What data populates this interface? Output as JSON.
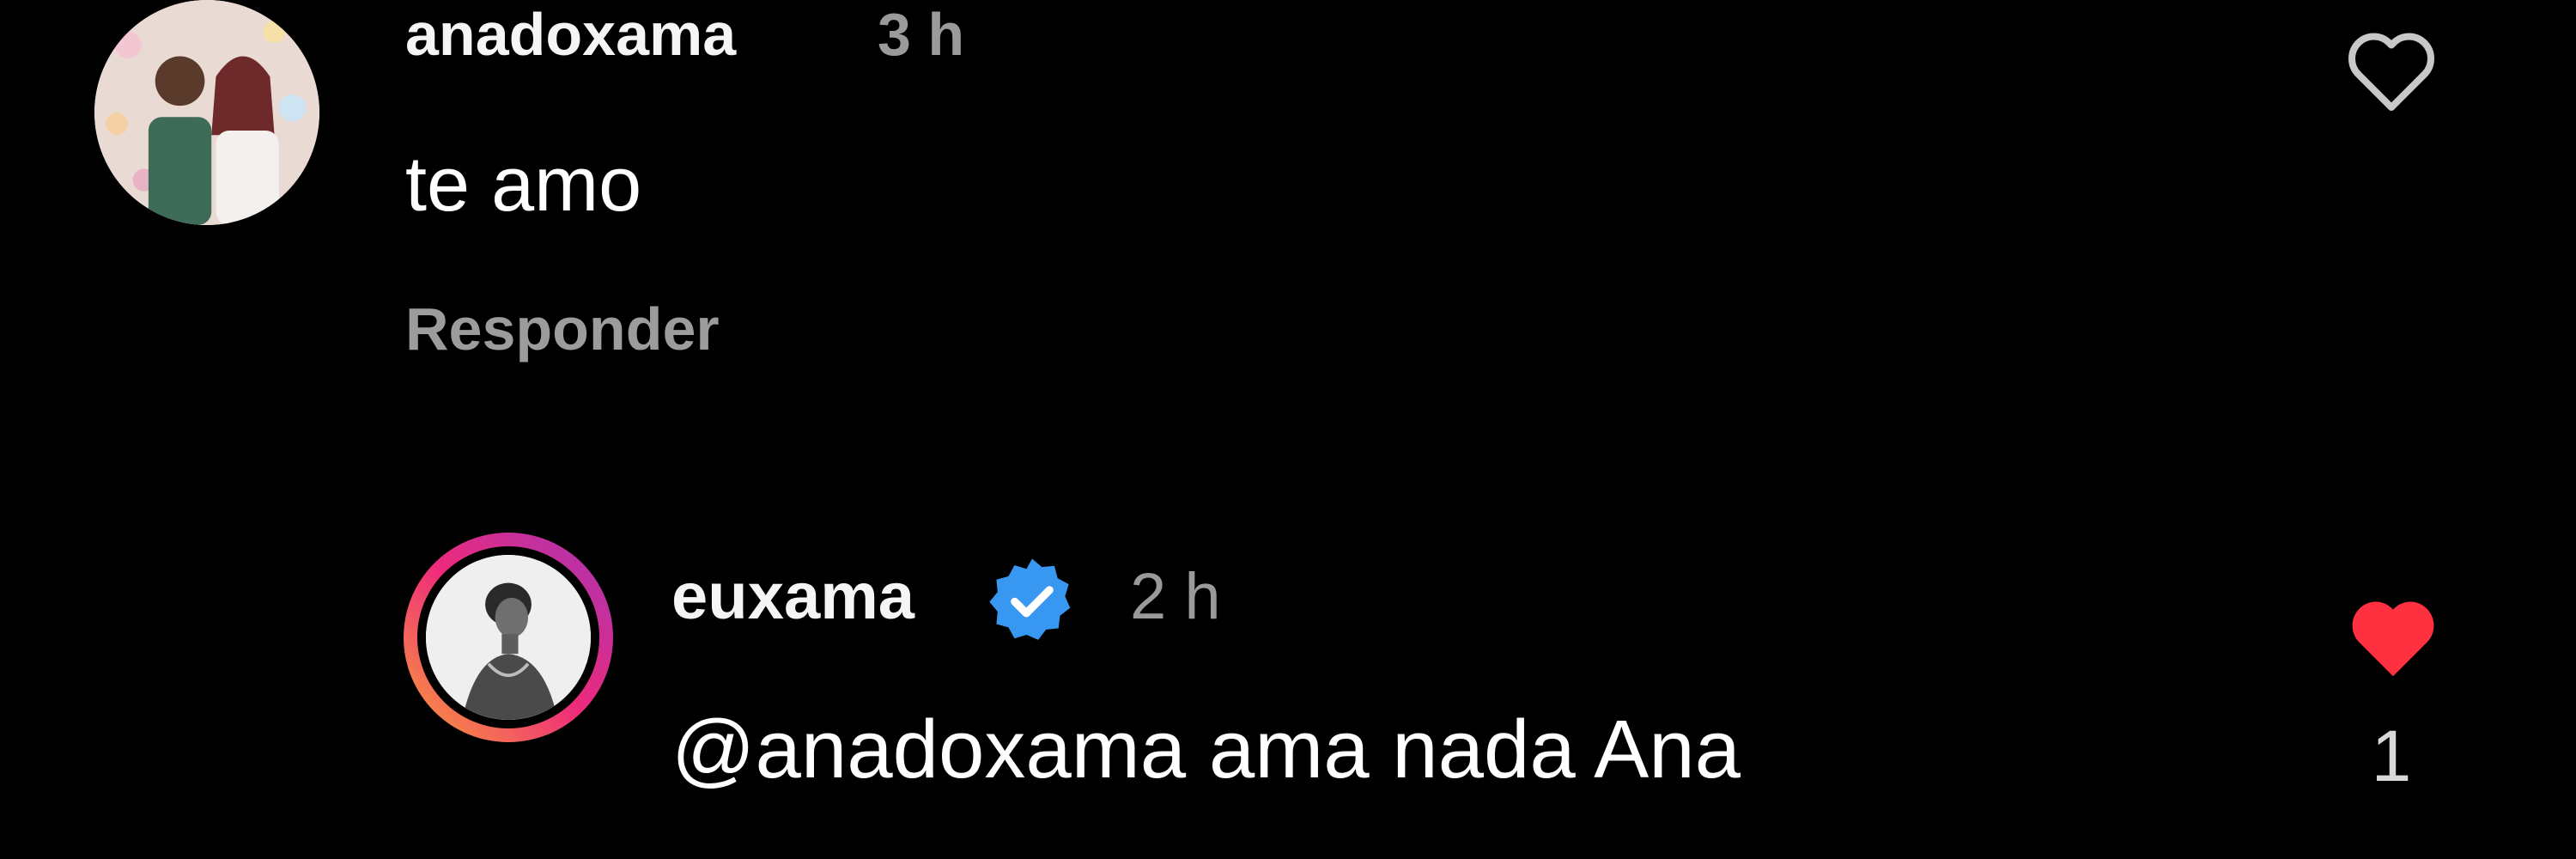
{
  "comments": [
    {
      "username": "anadoxama",
      "time": "3 h",
      "text": "te amo",
      "reply_label": "Responder",
      "avatar_icon": "user-avatar-couple-photo",
      "like_icon": "heart-outline-icon",
      "liked": false
    }
  ],
  "reply": {
    "username": "euxama",
    "verified": true,
    "verified_icon": "verified-badge-icon",
    "time": "2 h",
    "text": "@anadoxama ama nada Ana",
    "avatar_icon": "user-avatar-story-ring",
    "like_icon": "heart-filled-icon",
    "liked": true,
    "like_count": "1"
  },
  "colors": {
    "background": "#000000",
    "primary_text": "#ffffff",
    "secondary_text": "#9a9a9a",
    "like_red": "#ff3040",
    "verified_blue": "#3897f0"
  }
}
